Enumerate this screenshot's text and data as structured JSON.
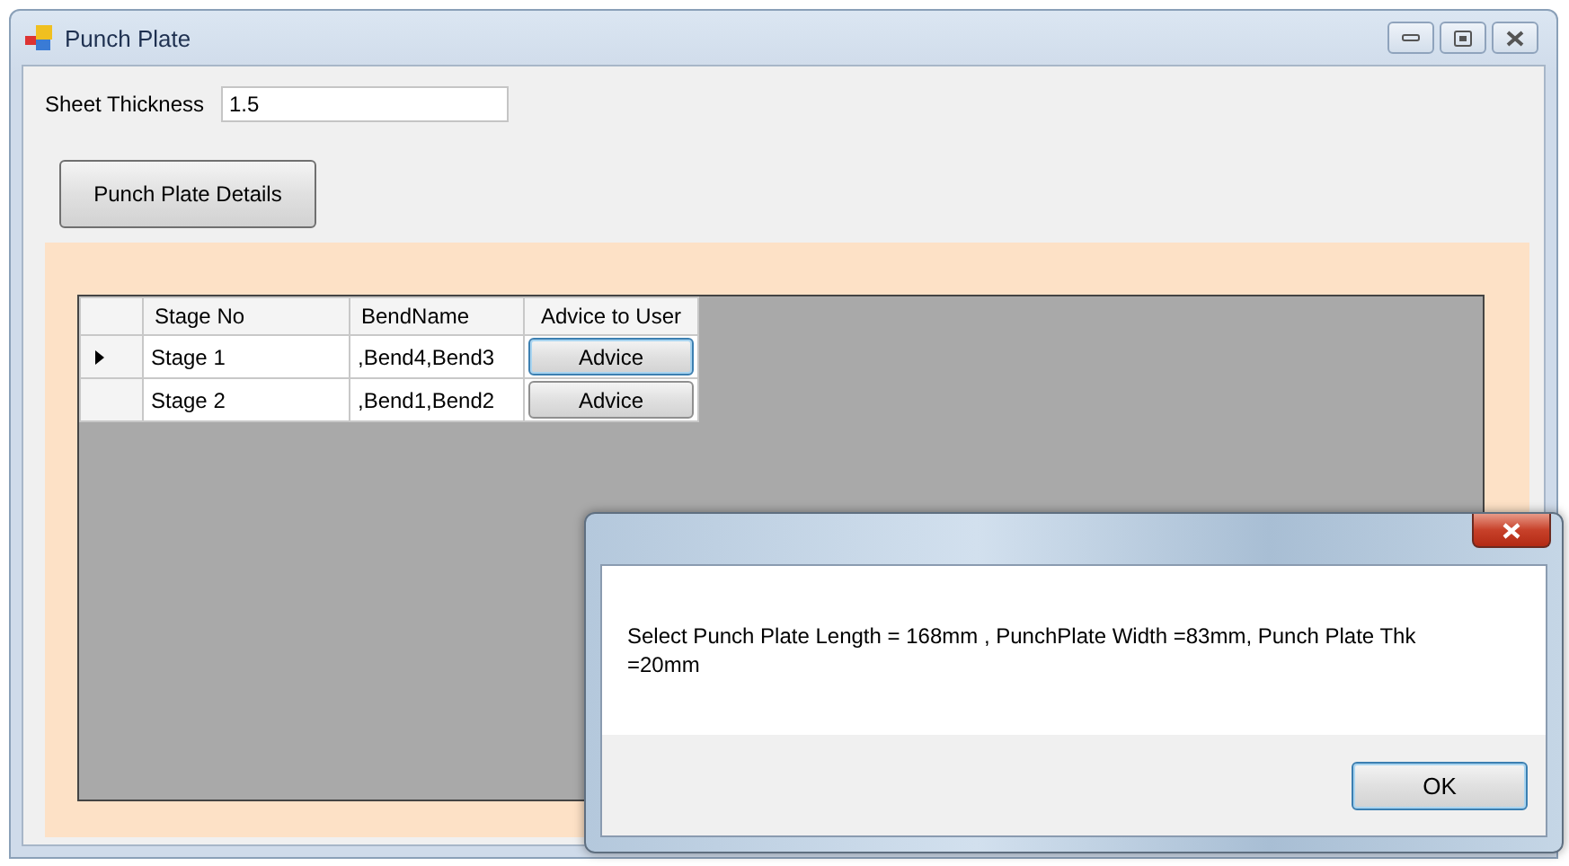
{
  "window": {
    "title": "Punch Plate"
  },
  "sheet_thickness": {
    "label": "Sheet Thickness",
    "value": "1.5"
  },
  "details_button": "Punch Plate Details",
  "grid": {
    "columns": [
      "Stage No",
      "BendName",
      "Advice to User"
    ],
    "rows": [
      {
        "stage": "Stage 1",
        "bends": ",Bend4,Bend3",
        "button": "Advice",
        "current": true,
        "focused": true
      },
      {
        "stage": "Stage 2",
        "bends": ",Bend1,Bend2",
        "button": "Advice",
        "current": false,
        "focused": false
      }
    ]
  },
  "dialog": {
    "message": "Select Punch Plate Length = 168mm , PunchPlate Width =83mm, Punch Plate Thk =20mm",
    "button": "OK"
  }
}
